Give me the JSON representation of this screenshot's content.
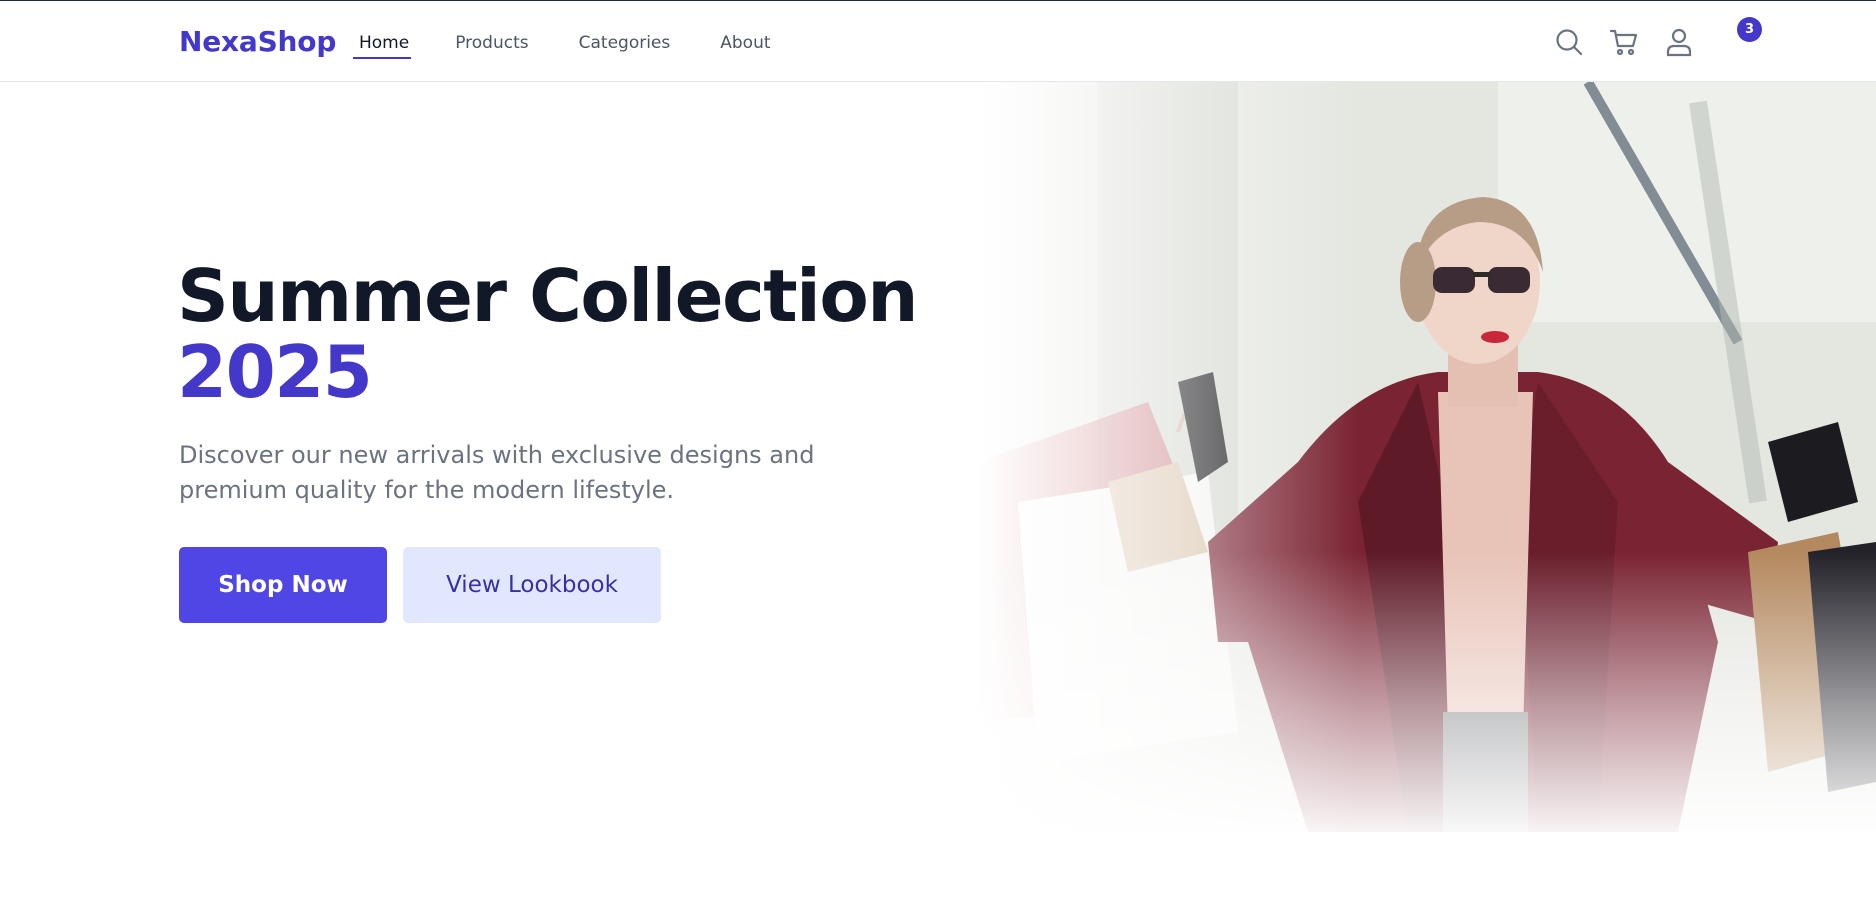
{
  "header": {
    "logo": "NexaShop",
    "nav": [
      {
        "label": "Home",
        "active": true
      },
      {
        "label": "Products"
      },
      {
        "label": "Categories"
      },
      {
        "label": "About"
      }
    ],
    "icons": [
      "search-icon",
      "cart-icon",
      "user-icon"
    ],
    "cart_count": "3"
  },
  "hero": {
    "title_line1": "Summer Collection",
    "title_line2": "2025",
    "subtitle": "Discover our new arrivals with exclusive designs and premium quality for the modern lifestyle.",
    "primary_button": "Shop Now",
    "secondary_button": "View Lookbook",
    "image_alt": "hero-photo"
  },
  "colors": {
    "brand": "#4338ca",
    "primary_button": "#4f46e5",
    "secondary_button_bg": "#e0e7ff",
    "heading": "#111827",
    "muted_text": "#6b7280"
  }
}
